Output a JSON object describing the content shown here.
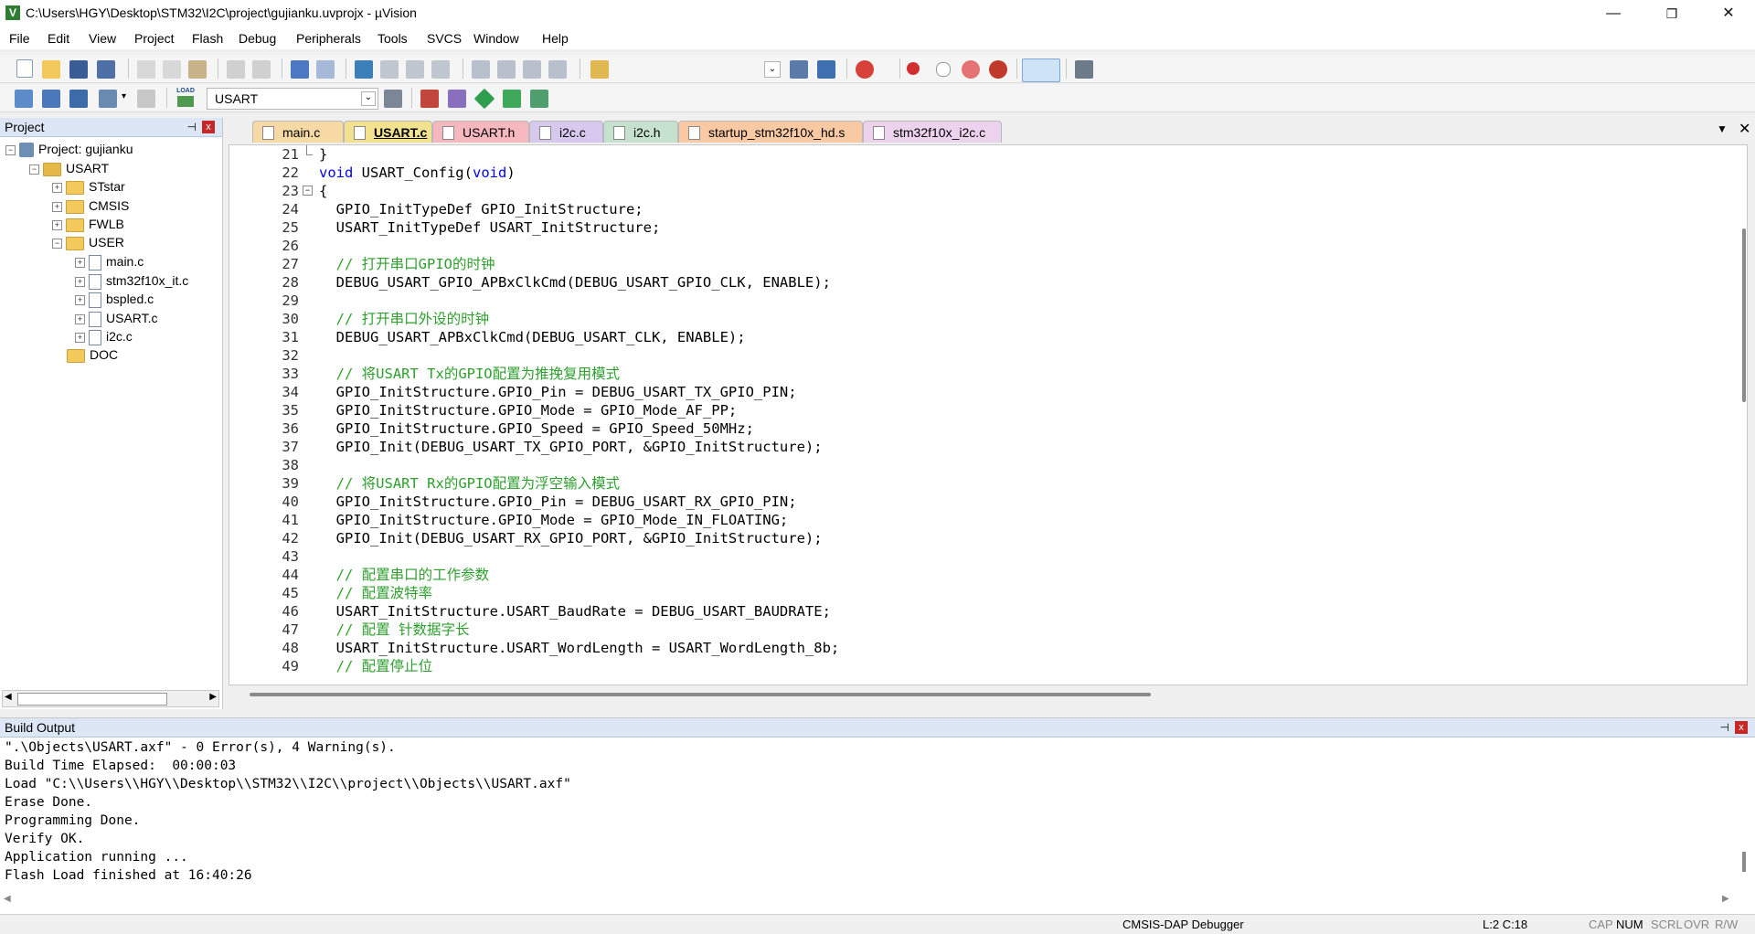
{
  "title_bar": {
    "title": "C:\\Users\\HGY\\Desktop\\STM32\\I2C\\project\\gujianku.uvprojx - µVision",
    "minimize": "—",
    "maximize": "❐",
    "close": "✕"
  },
  "menu": [
    "File",
    "Edit",
    "View",
    "Project",
    "Flash",
    "Debug",
    "Peripherals",
    "Tools",
    "SVCS",
    "Window",
    "Help"
  ],
  "toolbar2": {
    "load_label": "LOAD",
    "target_value": "USART"
  },
  "project_pane": {
    "title": "Project",
    "pin": "⊣",
    "close": "x",
    "tree": [
      {
        "label": "Project: gujianku"
      },
      {
        "label": "USART"
      },
      {
        "label": "STstar"
      },
      {
        "label": "CMSIS"
      },
      {
        "label": "FWLB"
      },
      {
        "label": "USER"
      },
      {
        "label": "main.c"
      },
      {
        "label": "stm32f10x_it.c"
      },
      {
        "label": "bspled.c"
      },
      {
        "label": "USART.c"
      },
      {
        "label": "i2c.c"
      },
      {
        "label": "DOC"
      }
    ]
  },
  "tabs": [
    {
      "label": "main.c",
      "color": "#f6d9a4"
    },
    {
      "label": "USART.c",
      "color": "#f2e28f",
      "active": true
    },
    {
      "label": "USART.h",
      "color": "#f4b8be"
    },
    {
      "label": "i2c.c",
      "color": "#d7c8ee"
    },
    {
      "label": "i2c.h",
      "color": "#c6e2cf"
    },
    {
      "label": "startup_stm32f10x_hd.s",
      "color": "#f8c9a2"
    },
    {
      "label": "stm32f10x_i2c.c",
      "color": "#ecd2ec"
    }
  ],
  "editor": {
    "lines": [
      {
        "n": "21",
        "parts": [
          {
            "t": "}",
            "c": ""
          }
        ]
      },
      {
        "n": "22",
        "parts": [
          {
            "t": "void",
            "c": "kw"
          },
          {
            "t": " USART_Config(",
            "c": ""
          },
          {
            "t": "void",
            "c": "kw"
          },
          {
            "t": ")",
            "c": ""
          }
        ]
      },
      {
        "n": "23",
        "parts": [
          {
            "t": "{",
            "c": ""
          }
        ]
      },
      {
        "n": "24",
        "parts": [
          {
            "t": "  GPIO_InitTypeDef GPIO_InitStructure;",
            "c": ""
          }
        ]
      },
      {
        "n": "25",
        "parts": [
          {
            "t": "  USART_InitTypeDef USART_InitStructure;",
            "c": ""
          }
        ]
      },
      {
        "n": "26",
        "parts": []
      },
      {
        "n": "27",
        "parts": [
          {
            "t": "  // 打开串口GPIO的时钟",
            "c": "cm"
          }
        ]
      },
      {
        "n": "28",
        "parts": [
          {
            "t": "  DEBUG_USART_GPIO_APBxClkCmd(DEBUG_USART_GPIO_CLK, ENABLE);",
            "c": ""
          }
        ]
      },
      {
        "n": "29",
        "parts": []
      },
      {
        "n": "30",
        "parts": [
          {
            "t": "  // 打开串口外设的时钟",
            "c": "cm"
          }
        ]
      },
      {
        "n": "31",
        "parts": [
          {
            "t": "  DEBUG_USART_APBxClkCmd(DEBUG_USART_CLK, ENABLE);",
            "c": ""
          }
        ]
      },
      {
        "n": "32",
        "parts": []
      },
      {
        "n": "33",
        "parts": [
          {
            "t": "  // 将USART Tx的GPIO配置为推挽复用模式",
            "c": "cm"
          }
        ]
      },
      {
        "n": "34",
        "parts": [
          {
            "t": "  GPIO_InitStructure.GPIO_Pin = DEBUG_USART_TX_GPIO_PIN;",
            "c": ""
          }
        ]
      },
      {
        "n": "35",
        "parts": [
          {
            "t": "  GPIO_InitStructure.GPIO_Mode = GPIO_Mode_AF_PP;",
            "c": ""
          }
        ]
      },
      {
        "n": "36",
        "parts": [
          {
            "t": "  GPIO_InitStructure.GPIO_Speed = GPIO_Speed_50MHz;",
            "c": ""
          }
        ]
      },
      {
        "n": "37",
        "parts": [
          {
            "t": "  GPIO_Init(DEBUG_USART_TX_GPIO_PORT, &GPIO_InitStructure);",
            "c": ""
          }
        ]
      },
      {
        "n": "38",
        "parts": []
      },
      {
        "n": "39",
        "parts": [
          {
            "t": "  // 将USART Rx的GPIO配置为浮空输入模式",
            "c": "cm"
          }
        ]
      },
      {
        "n": "40",
        "parts": [
          {
            "t": "  GPIO_InitStructure.GPIO_Pin = DEBUG_USART_RX_GPIO_PIN;",
            "c": ""
          }
        ]
      },
      {
        "n": "41",
        "parts": [
          {
            "t": "  GPIO_InitStructure.GPIO_Mode = GPIO_Mode_IN_FLOATING;",
            "c": ""
          }
        ]
      },
      {
        "n": "42",
        "parts": [
          {
            "t": "  GPIO_Init(DEBUG_USART_RX_GPIO_PORT, &GPIO_InitStructure);",
            "c": ""
          }
        ]
      },
      {
        "n": "43",
        "parts": []
      },
      {
        "n": "44",
        "parts": [
          {
            "t": "  // 配置串口的工作参数",
            "c": "cm"
          }
        ]
      },
      {
        "n": "45",
        "parts": [
          {
            "t": "  // 配置波特率",
            "c": "cm"
          }
        ]
      },
      {
        "n": "46",
        "parts": [
          {
            "t": "  USART_InitStructure.USART_BaudRate = DEBUG_USART_BAUDRATE;",
            "c": ""
          }
        ]
      },
      {
        "n": "47",
        "parts": [
          {
            "t": "  // 配置 针数据字长",
            "c": "cm"
          }
        ]
      },
      {
        "n": "48",
        "parts": [
          {
            "t": "  USART_InitStructure.USART_WordLength = USART_WordLength_8b;",
            "c": ""
          }
        ]
      },
      {
        "n": "49",
        "parts": [
          {
            "t": "  // 配置停止位",
            "c": "cm"
          }
        ]
      }
    ]
  },
  "build_output": {
    "title": "Build Output",
    "pin": "⊣",
    "close": "x",
    "lines": [
      "\".\\Objects\\USART.axf\" - 0 Error(s), 4 Warning(s).",
      "Build Time Elapsed:  00:00:03",
      "Load \"C:\\\\Users\\\\HGY\\\\Desktop\\\\STM32\\\\I2C\\\\project\\\\Objects\\\\USART.axf\"",
      "Erase Done.",
      "Programming Done.",
      "Verify OK.",
      "Application running ...",
      "Flash Load finished at 16:40:26"
    ]
  },
  "status_bar": {
    "debugger": "CMSIS-DAP Debugger",
    "position": "L:2 C:18",
    "cap": "CAP",
    "num": "NUM",
    "scrl": "SCRL",
    "ovr": "OVR",
    "rw": "R/W"
  }
}
